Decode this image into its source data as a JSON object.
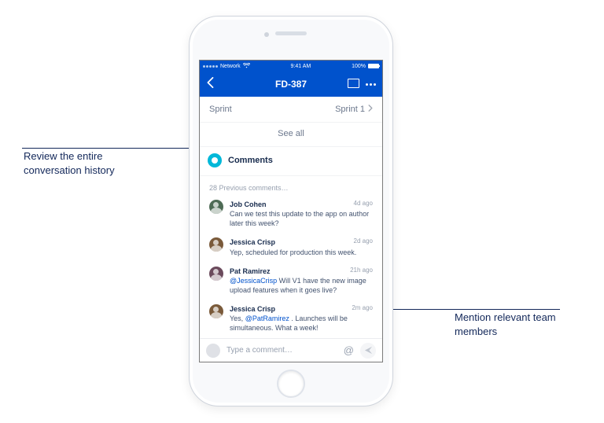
{
  "callouts": {
    "left": "Review the entire conversation history",
    "right": "Mention relevant team members"
  },
  "status": {
    "carrier": "Network",
    "time": "9:41 AM",
    "battery": "100%"
  },
  "nav": {
    "title": "FD-387"
  },
  "field": {
    "label": "Sprint",
    "value": "Sprint 1"
  },
  "see_all": "See all",
  "section": {
    "title": "Comments"
  },
  "previous": "28 Previous comments…",
  "comments": [
    {
      "author": "Job Cohen",
      "time": "4d ago",
      "mention": "",
      "text": "Can we test this update to the app on author later this week?"
    },
    {
      "author": "Jessica Crisp",
      "time": "2d ago",
      "mention": "",
      "text": "Yep, scheduled for production this week."
    },
    {
      "author": "Pat Ramirez",
      "time": "21h ago",
      "mention": "@JessicaCrisp",
      "text": " Will V1 have the new image upload features when it goes live?"
    },
    {
      "author": "Jessica Crisp",
      "time": "2m ago",
      "mention": "@PatRamirez",
      "prefix": "Yes, ",
      "text": " . Launches will be simultaneous. What a week!"
    }
  ],
  "composer": {
    "placeholder": "Type a comment…",
    "at": "@"
  },
  "avatar_colors": [
    "#4e6b55",
    "#7a5a3a",
    "#6b4a5c",
    "#7a5a3a"
  ]
}
